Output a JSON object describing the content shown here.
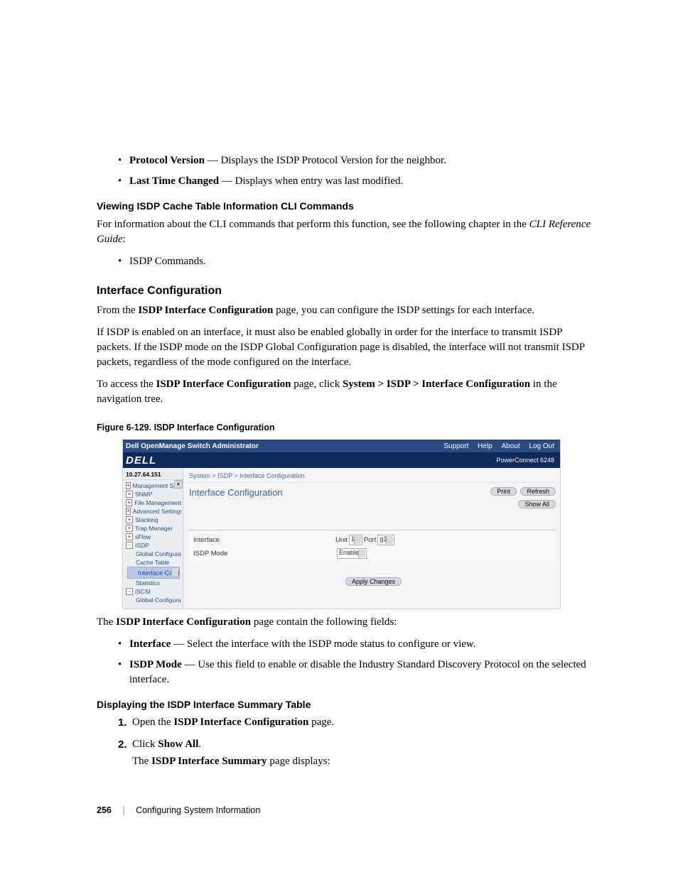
{
  "bullet_top": [
    {
      "term": "Protocol Version",
      "desc": " — Displays the ISDP Protocol Version for the neighbor."
    },
    {
      "term": "Last Time Changed",
      "desc": " — Displays when entry was last modified."
    }
  ],
  "sub1_title": "Viewing ISDP Cache Table Information CLI Commands",
  "sub1_para_a": "For information about the CLI commands that perform this function, see the following chapter in the ",
  "sub1_para_b": "CLI Reference Guide",
  "sub1_para_c": ":",
  "sub1_bullet": "ISDP Commands.",
  "h2": "Interface Configuration",
  "p1_a": "From the ",
  "p1_b": "ISDP Interface Configuration",
  "p1_c": " page, you can configure the ISDP settings for each interface.",
  "p2": "If ISDP is enabled on an interface, it must also be enabled globally in order for the interface to transmit ISDP packets. If the ISDP mode on the ISDP Global Configuration page is disabled, the interface will not transmit ISDP packets, regardless of the mode configured on the interface.",
  "p3_a": "To access the ",
  "p3_b": "ISDP Interface Configuration",
  "p3_c": " page, click ",
  "p3_d": "System > ISDP > Interface Configuration",
  "p3_e": " in the navigation tree.",
  "figcap": "Figure 6-129.    ISDP Interface Configuration",
  "shot": {
    "topbar_title": "Dell OpenManage Switch Administrator",
    "topbar_links": [
      "Support",
      "Help",
      "About",
      "Log Out"
    ],
    "logo": "DELL",
    "model": "PowerConnect 6248",
    "ip": "10.27.64.151",
    "tree": [
      {
        "lvl": 0,
        "exp": "+",
        "label": "Management Secur"
      },
      {
        "lvl": 0,
        "exp": "+",
        "label": "SNMP"
      },
      {
        "lvl": 0,
        "exp": "+",
        "label": "File Management"
      },
      {
        "lvl": 0,
        "exp": "+",
        "label": "Advanced Settings"
      },
      {
        "lvl": 0,
        "exp": "+",
        "label": "Stacking"
      },
      {
        "lvl": 0,
        "exp": "+",
        "label": "Trap Manager"
      },
      {
        "lvl": 0,
        "exp": "+",
        "label": "sFlow"
      },
      {
        "lvl": 0,
        "exp": "-",
        "label": "ISDP"
      },
      {
        "lvl": 1,
        "exp": "",
        "label": "Global Configurat"
      },
      {
        "lvl": 1,
        "exp": "",
        "label": "Cache Table"
      },
      {
        "lvl": 1,
        "exp": "",
        "label": "Interface Configu",
        "sel": true
      },
      {
        "lvl": 1,
        "exp": "",
        "label": "Statistics"
      },
      {
        "lvl": 0,
        "exp": "-",
        "label": "iSCSI"
      },
      {
        "lvl": 1,
        "exp": "",
        "label": "Global Configurat"
      }
    ],
    "crumb": "System > ISDP > Interface Configuration",
    "panel_title": "Interface Configuration",
    "btn_print": "Print",
    "btn_refresh": "Refresh",
    "btn_showall": "Show All",
    "row_interface_label": "Interface",
    "row_interface_unit": "Unit",
    "row_interface_unit_v": "1",
    "row_interface_port": "Port",
    "row_interface_port_v": "g1",
    "row_mode_label": "ISDP Mode",
    "row_mode_value": "Enable",
    "apply": "Apply Changes"
  },
  "p4_a": "The ",
  "p4_b": "ISDP Interface Configuration",
  "p4_c": " page contain the following fields:",
  "fields": [
    {
      "term": "Interface",
      "desc": " — Select the interface with the ISDP mode status to configure or view."
    },
    {
      "term": "ISDP Mode",
      "desc": " — Use this field to enable or disable the Industry Standard Discovery Protocol on the selected interface."
    }
  ],
  "sub2_title": "Displaying the ISDP Interface Summary Table",
  "steps": [
    {
      "pre": "Open the ",
      "bold": "ISDP Interface Configuration",
      "post": " page."
    },
    {
      "pre": "Click ",
      "bold": "Show All",
      "post": "."
    }
  ],
  "step2_cont_a": "The ",
  "step2_cont_b": "ISDP Interface Summary",
  "step2_cont_c": " page displays:",
  "footer_page": "256",
  "footer_text": "Configuring System Information"
}
